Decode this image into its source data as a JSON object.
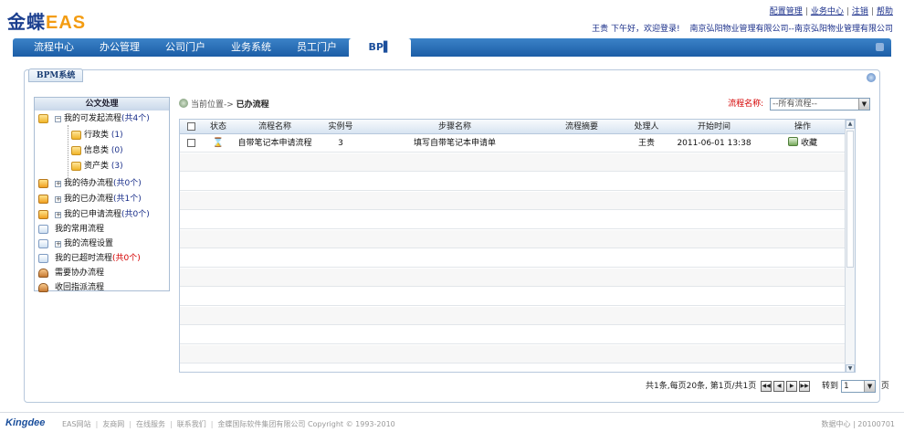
{
  "header": {
    "logo_cn": "金蝶",
    "logo_eas": "EAS",
    "links": [
      "配置管理",
      "业务中心",
      "注销",
      "帮助"
    ],
    "greeting": "王贵 下午好，欢迎登录!",
    "org": "南京弘阳物业管理有限公司--南京弘阳物业管理有限公司"
  },
  "nav": {
    "tabs": [
      "流程中心",
      "办公管理",
      "公司门户",
      "业务系统",
      "员工门户",
      "BP▌"
    ],
    "active": "BP▌"
  },
  "panel": {
    "title": "BPM系统"
  },
  "sidebar": {
    "heading": "公文处理",
    "items": [
      {
        "label": "我的可发起流程",
        "count": "(共4个)"
      },
      {
        "label": "行政类",
        "count": "(1)"
      },
      {
        "label": "信息类",
        "count": "(0)"
      },
      {
        "label": "资产类",
        "count": "(3)"
      },
      {
        "label": "我的待办流程",
        "count": "(共0个)"
      },
      {
        "label": "我的已办流程",
        "count": "(共1个)"
      },
      {
        "label": "我的已申请流程",
        "count": "(共0个)"
      },
      {
        "label": "我的常用流程",
        "count": ""
      },
      {
        "label": "我的流程设置",
        "count": ""
      },
      {
        "label": "我的已超时流程",
        "count": "(共0个)"
      },
      {
        "label": "需要协办流程",
        "count": ""
      },
      {
        "label": "收回指派流程",
        "count": ""
      }
    ]
  },
  "breadcrumb": {
    "prefix": "当前位置->",
    "current": "已办流程"
  },
  "filter": {
    "label": "流程名称:",
    "selected": "--所有流程--"
  },
  "grid": {
    "columns": [
      "状态",
      "流程名称",
      "实例号",
      "步骤名称",
      "流程摘要",
      "处理人",
      "开始时间",
      "操作"
    ],
    "rows": [
      {
        "status_icon": "hourglass-icon",
        "process_name": "自带笔记本申请流程",
        "instance_no": "3",
        "step_name": "填写自带笔记本申请单",
        "summary": "",
        "handler": "王贵",
        "start_time": "2011-06-01 13:38",
        "action": "收藏"
      }
    ]
  },
  "pager": {
    "summary": "共1条,每页20条, 第1页/共1页",
    "goto_label": "转到",
    "page_value": "1",
    "page_unit": "页"
  },
  "footer": {
    "brand": "Kingdee",
    "links": [
      "EAS网站",
      "友商网",
      "在线服务",
      "联系我们",
      "金蝶国际软件集团有限公司 Copyright © 1993-2010"
    ],
    "right": "数据中心 | 20100701"
  }
}
